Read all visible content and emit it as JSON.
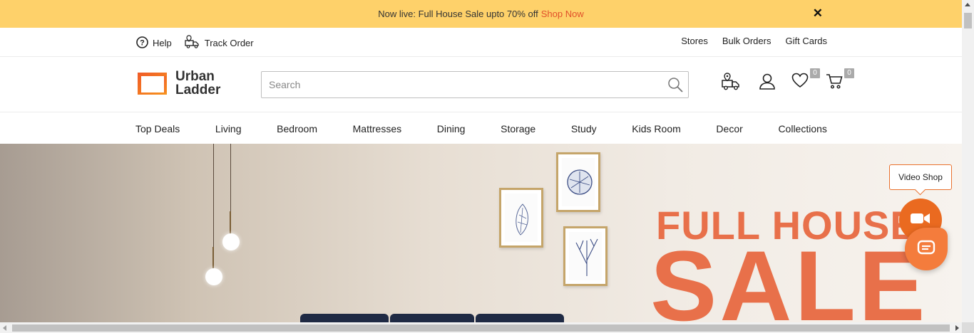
{
  "promo": {
    "text": "Now live: Full House Sale upto 70% off",
    "link": "Shop Now",
    "close": "✕",
    "bg_color": "#fed16a",
    "link_color": "#e1502a"
  },
  "utility": {
    "help": "Help",
    "track_order": "Track Order",
    "right_links": [
      "Stores",
      "Bulk Orders",
      "Gift Cards"
    ]
  },
  "header": {
    "logo_line1": "Urban",
    "logo_line2": "Ladder",
    "search_placeholder": "Search",
    "wishlist_count": "0",
    "cart_count": "0",
    "icons": [
      "truck-location-icon",
      "user-icon",
      "heart-icon",
      "cart-icon"
    ]
  },
  "nav": {
    "items": [
      "Top Deals",
      "Living",
      "Bedroom",
      "Mattresses",
      "Dining",
      "Storage",
      "Study",
      "Kids Room",
      "Decor",
      "Collections"
    ]
  },
  "hero": {
    "line1": "FULL HOUSE",
    "line2": "SALE",
    "accent_color": "#e8704a"
  },
  "widgets": {
    "video_shop": "Video Shop",
    "brand_orange": "#ea6a20"
  }
}
